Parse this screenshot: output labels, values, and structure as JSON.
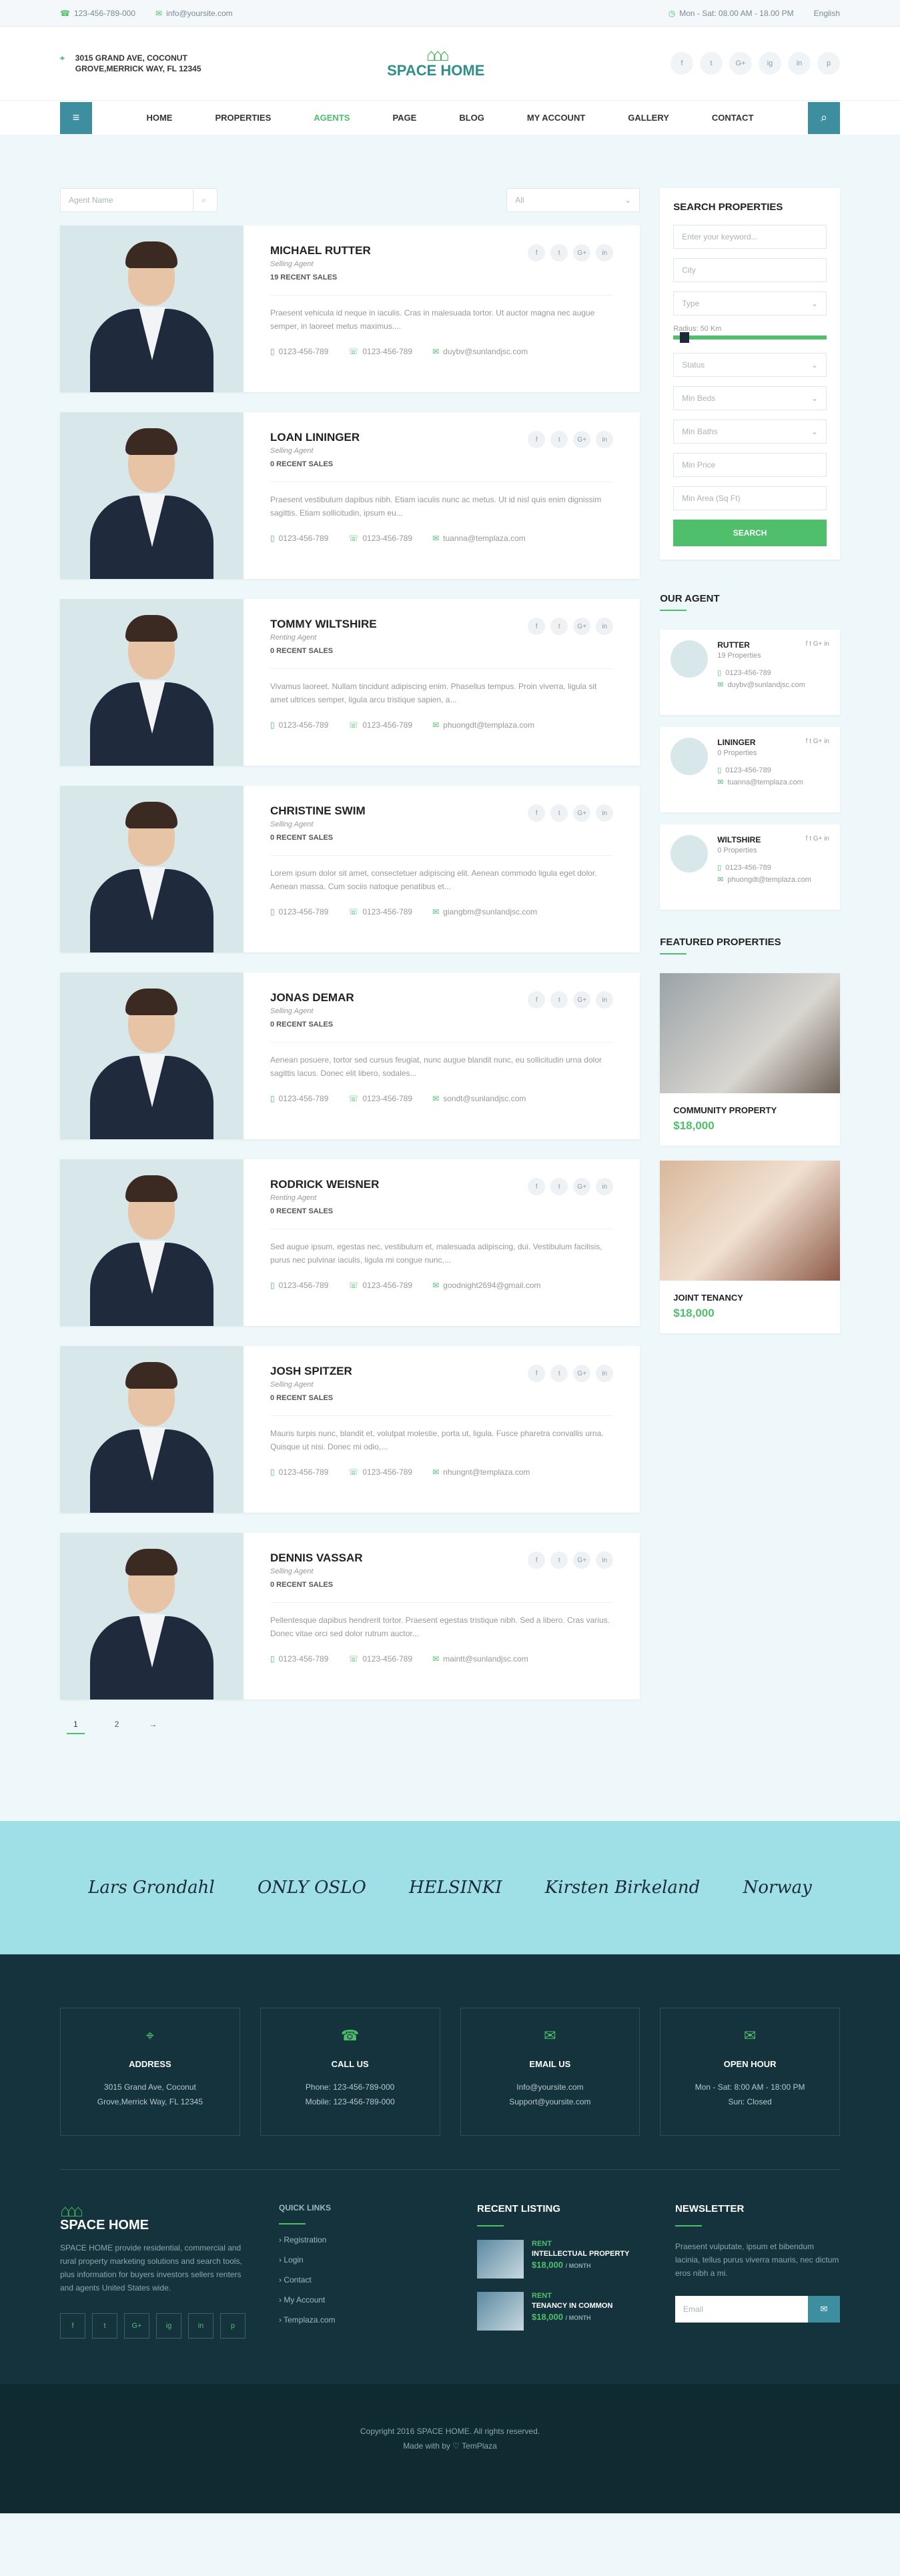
{
  "topbar": {
    "phone": "123-456-789-000",
    "email": "info@yoursite.com",
    "hours": "Mon - Sat: 08.00 AM - 18.00 PM",
    "lang": "English"
  },
  "header": {
    "address_line1": "3015 GRAND AVE, COCONUT",
    "address_line2": "GROVE,MERRICK WAY, FL 12345",
    "logo": "SPACE HOME",
    "socials": [
      "f",
      "t",
      "G+",
      "ig",
      "in",
      "p"
    ]
  },
  "nav": {
    "items": [
      "HOME",
      "PROPERTIES",
      "AGENTS",
      "PAGE",
      "BLOG",
      "MY ACCOUNT",
      "GALLERY",
      "CONTACT"
    ],
    "active": "AGENTS"
  },
  "filters": {
    "agent_placeholder": "Agent Name",
    "select": "All"
  },
  "agents": [
    {
      "name": "MICHAEL RUTTER",
      "role": "Selling Agent",
      "sales": "19 RECENT SALES",
      "desc": "Praesent vehicula id neque in iaculis. Cras in malesuada tortor. Ut auctor magna nec augue semper, in laoreet metus maximus....",
      "phone1": "0123-456-789",
      "phone2": "0123-456-789",
      "email": "duybv@sunlandjsc.com"
    },
    {
      "name": "LOAN LININGER",
      "role": "Selling Agent",
      "sales": "0 RECENT SALES",
      "desc": "Praesent vestibulum dapibus nibh. Etiam iaculis nunc ac metus. Ut id nisl quis enim dignissim sagittis. Etiam sollicitudin, ipsum eu...",
      "phone1": "0123-456-789",
      "phone2": "0123-456-789",
      "email": "tuanna@templaza.com"
    },
    {
      "name": "TOMMY WILTSHIRE",
      "role": "Renting Agent",
      "sales": "0 RECENT SALES",
      "desc": "Vivamus laoreet. Nullam tincidunt adipiscing enim. Phasellus tempus. Proin viverra, ligula sit amet ultrices semper, ligula arcu tristique sapien, a...",
      "phone1": "0123-456-789",
      "phone2": "0123-456-789",
      "email": "phuongdt@templaza.com"
    },
    {
      "name": "CHRISTINE SWIM",
      "role": "Selling Agent",
      "sales": "0 RECENT SALES",
      "desc": "Lorem ipsum dolor sit amet, consectetuer adipiscing elit. Aenean commodo ligula eget dolor. Aenean massa. Cum sociis natoque penatibus et...",
      "phone1": "0123-456-789",
      "phone2": "0123-456-789",
      "email": "giangbm@sunlandjsc.com"
    },
    {
      "name": "JONAS DEMAR",
      "role": "Selling Agent",
      "sales": "0 RECENT SALES",
      "desc": "Aenean posuere, tortor sed cursus feugiat, nunc augue blandit nunc, eu sollicitudin urna dolor sagittis lacus. Donec elit libero, sodales...",
      "phone1": "0123-456-789",
      "phone2": "0123-456-789",
      "email": "sondt@sunlandjsc.com"
    },
    {
      "name": "RODRICK WEISNER",
      "role": "Renting Agent",
      "sales": "0 RECENT SALES",
      "desc": "Sed augue ipsum, egestas nec, vestibulum et, malesuada adipiscing, dui. Vestibulum facilisis, purus nec pulvinar iaculis, ligula mi congue nunc,...",
      "phone1": "0123-456-789",
      "phone2": "0123-456-789",
      "email": "goodnight2694@gmail.com"
    },
    {
      "name": "JOSH SPITZER",
      "role": "Selling Agent",
      "sales": "0 RECENT SALES",
      "desc": "Mauris turpis nunc, blandit et, volutpat molestie, porta ut, ligula. Fusce pharetra convallis urna. Quisque ut nisi. Donec mi odio,...",
      "phone1": "0123-456-789",
      "phone2": "0123-456-789",
      "email": "nhungnt@templaza.com"
    },
    {
      "name": "DENNIS VASSAR",
      "role": "Selling Agent",
      "sales": "0 RECENT SALES",
      "desc": "Pellentesque dapibus hendrerit tortor. Praesent egestas tristique nibh. Sed a libero. Cras varius. Donec vitae orci sed dolor rutrum auctor...",
      "phone1": "0123-456-789",
      "phone2": "0123-456-789",
      "email": "maintt@sunlandjsc.com"
    }
  ],
  "pagination": {
    "p1": "1",
    "p2": "2",
    "next": "→"
  },
  "search": {
    "title": "SEARCH PROPERTIES",
    "keyword": "Enter your keyword...",
    "city": "City",
    "type": "Type",
    "radius": "Radius: 50 Km",
    "status": "Status",
    "beds": "Min Beds",
    "baths": "Min Baths",
    "price": "Min Price",
    "area": "Min Area (Sq Ft)",
    "button": "SEARCH"
  },
  "our_agent": {
    "title": "OUR AGENT",
    "items": [
      {
        "name": "RUTTER",
        "props": "19 Properties",
        "phone": "0123-456-789",
        "email": "duybv@sunlandjsc.com"
      },
      {
        "name": "LININGER",
        "props": "0 Properties",
        "phone": "0123-456-789",
        "email": "tuanna@templaza.com"
      },
      {
        "name": "WILTSHIRE",
        "props": "0 Properties",
        "phone": "0123-456-789",
        "email": "phuongdt@templaza.com"
      }
    ]
  },
  "featured": {
    "title": "FEATURED PROPERTIES",
    "items": [
      {
        "name": "COMMUNITY PROPERTY",
        "price": "$18,000"
      },
      {
        "name": "JOINT TENANCY",
        "price": "$18,000"
      }
    ]
  },
  "partners": [
    "Lars Grondahl",
    "ONLY OSLO",
    "HELSINKI",
    "Kirsten Birkeland",
    "Norway"
  ],
  "contact_cards": [
    {
      "title": "ADDRESS",
      "l1": "3015 Grand Ave, Coconut",
      "l2": "Grove,Merrick Way, FL 12345"
    },
    {
      "title": "CALL US",
      "l1": "Phone: 123-456-789-000",
      "l2": "Mobile: 123-456-789-000"
    },
    {
      "title": "EMAIL US",
      "l1": "Info@yoursite.com",
      "l2": "Support@yoursite.com"
    },
    {
      "title": "OPEN HOUR",
      "l1": "Mon - Sat: 8:00 AM - 18:00 PM",
      "l2": "Sun: Closed"
    }
  ],
  "footer": {
    "about": "SPACE HOME provide residential, commercial and rural property marketing solutions and search tools, plus information for buyers investors sellers renters and agents United States wide.",
    "quick_title": "QUICK LINKS",
    "quick": [
      "Registration",
      "Login",
      "Contact",
      "My Account",
      "Templaza.com"
    ],
    "recent_title": "RECENT LISTING",
    "recent": [
      {
        "tag": "RENT",
        "name": "INTELLECTUAL PROPERTY",
        "price": "$18,000",
        "unit": "/ MONTH"
      },
      {
        "tag": "RENT",
        "name": "TENANCY IN COMMON",
        "price": "$18,000",
        "unit": "/ MONTH"
      }
    ],
    "news_title": "NEWSLETTER",
    "news": "Praesent vulputate, ipsum et bibendum lacinia, tellus purus viverra mauris, nec dictum eros nibh a mi.",
    "email_ph": "Email",
    "copyright": "Copyright 2016 SPACE HOME. All rights reserved.",
    "made": "Made with by ♡ TemPlaza"
  }
}
